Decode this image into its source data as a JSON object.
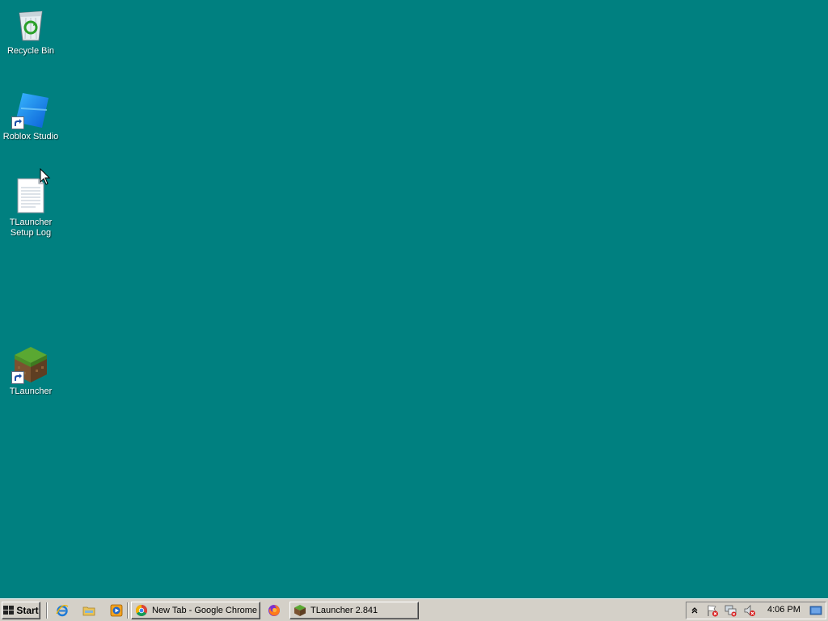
{
  "desktop": {
    "background": "#008080",
    "icons": [
      {
        "label": "Recycle Bin",
        "icon": "recycle-bin-icon"
      },
      {
        "label": "Roblox Studio",
        "icon": "roblox-studio-icon"
      },
      {
        "label": "TLauncher\nSetup Log",
        "icon": "text-document-icon"
      },
      {
        "label": "TLauncher",
        "icon": "minecraft-grass-block-icon"
      }
    ]
  },
  "taskbar": {
    "start_label": "Start",
    "quick_launch": [
      "internet-explorer-icon",
      "folder-icon",
      "media-player-icon"
    ],
    "tasks": [
      {
        "label": "New Tab - Google Chrome",
        "icon": "chrome-icon"
      },
      {
        "label": "TLauncher 2.841",
        "icon": "minecraft-grass-block-icon"
      }
    ],
    "pinned_between": "firefox-icon",
    "tray": {
      "icons": [
        "show-hidden-icons-chevron",
        "action-center-flag-icon",
        "network-disconnected-icon",
        "volume-muted-icon"
      ],
      "clock": "4:06 PM",
      "show_desktop": "show-desktop-icon"
    }
  }
}
